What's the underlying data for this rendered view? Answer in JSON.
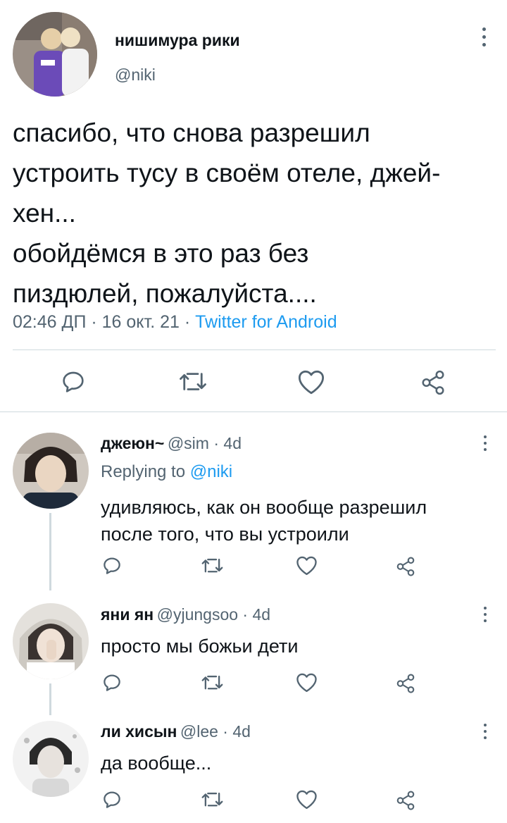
{
  "main": {
    "author_name": "нишимура рики",
    "author_handle": "@niki",
    "text": "спасибо, что снова разрешил\nустроить тусу в своём отеле, джей-\nхен...\nобойдёмся в это раз без\nпиздюлей, пожалуйста....",
    "time": "02:46 ДП",
    "date": "16 окт. 21",
    "source": "Twitter for Android",
    "sep": " · "
  },
  "replies": [
    {
      "name": "джеюн~",
      "handle": "@sim",
      "age": "4d",
      "replying_prefix": "Replying to ",
      "replying_mention": "@niki",
      "text": "удивляюсь, как он вообще разрешил\nпосле того, что вы устроили"
    },
    {
      "name": "яни ян",
      "handle": "@yjungsoo",
      "age": "4d",
      "text": "просто мы божьи дети"
    },
    {
      "name": "ли хисын",
      "handle": "@lee",
      "age": "4d",
      "text": "да вообще..."
    }
  ],
  "icons": {
    "reply": "reply-icon",
    "retweet": "retweet-icon",
    "like": "like-icon",
    "share": "share-icon",
    "more": "more-vertical-icon"
  },
  "colors": {
    "text": "#0f1419",
    "secondary": "#536471",
    "accent": "#1d9bf0",
    "divider": "#cfd9de"
  }
}
